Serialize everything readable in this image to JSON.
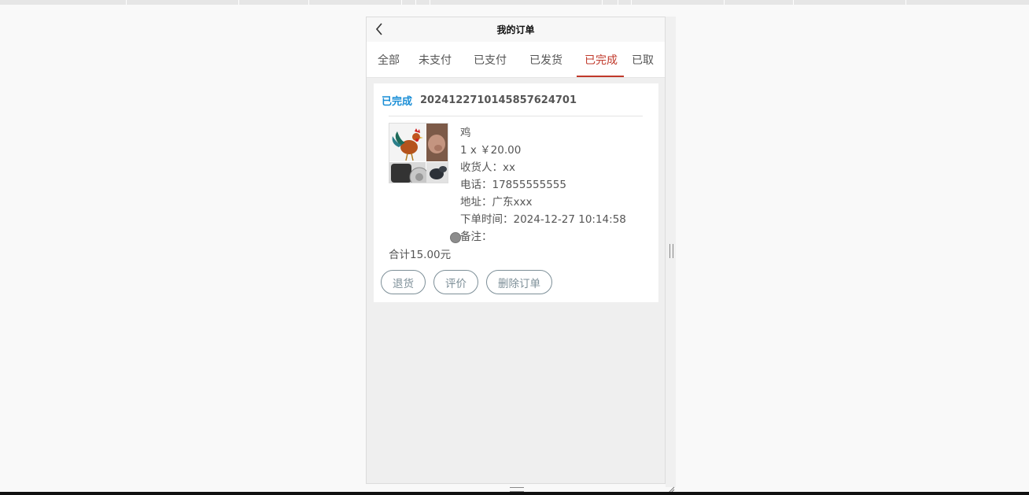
{
  "navbar": {
    "title": "我的订单"
  },
  "tabs": [
    {
      "label": "全部",
      "active": false
    },
    {
      "label": "未支付",
      "active": false
    },
    {
      "label": "已支付",
      "active": false
    },
    {
      "label": "已发货",
      "active": false
    },
    {
      "label": "已完成",
      "active": true
    },
    {
      "label": "已取",
      "active": false
    }
  ],
  "order": {
    "status": "已完成",
    "order_no": "20241227101458576247​01",
    "product_name": "鸡",
    "qty_price": "1 x ￥20.00",
    "receiver": "收货人：xx",
    "phone": "电话：17855555555",
    "address": "地址：广东xxx",
    "order_time": "下单时间：2024-12-27 10:14:58",
    "note": "备注：",
    "total": "合计15.00元",
    "buttons": {
      "return": "退货",
      "review": "评价",
      "delete": "删除订单"
    }
  },
  "colors": {
    "active_tab": "#c0392b",
    "status": "#1a8ed6",
    "button_border": "#7d8f98"
  }
}
